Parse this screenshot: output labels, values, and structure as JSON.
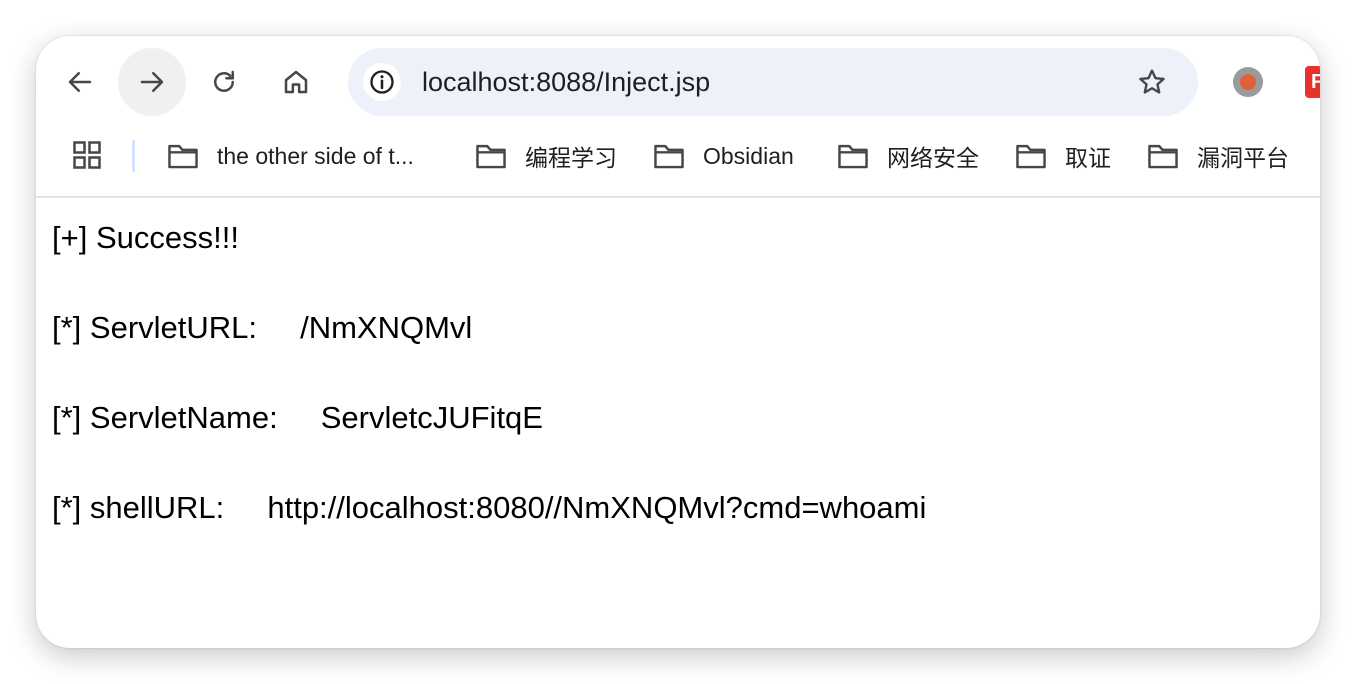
{
  "toolbar": {
    "back_icon": "arrow-left-icon",
    "forward_icon": "arrow-right-icon",
    "reload_icon": "reload-icon",
    "home_icon": "home-icon",
    "url": "localhost:8088/Inject.jsp",
    "site_info_icon": "info-icon",
    "bookmark_star_icon": "star-icon",
    "extension_icons": [
      "record-extension-icon",
      "red-extension-icon"
    ],
    "red_extension_letter": "F"
  },
  "bookmarks_bar": {
    "apps_icon": "apps-grid-icon",
    "items": [
      {
        "label": "the other side of t...",
        "icon": "folder-icon"
      },
      {
        "label": "编程学习",
        "icon": "folder-icon"
      },
      {
        "label": "Obsidian",
        "icon": "folder-icon"
      },
      {
        "label": "网络安全",
        "icon": "folder-icon"
      },
      {
        "label": "取证",
        "icon": "folder-icon"
      },
      {
        "label": "漏洞平台",
        "icon": "folder-icon"
      }
    ]
  },
  "page": {
    "lines": [
      "[+] Success!!!",
      "[*] ServletURL:     /NmXNQMvl",
      "[*] ServletName:     ServletcJUFitqE",
      "[*] shellURL:     http://localhost:8080//NmXNQMvl?cmd=whoami"
    ]
  },
  "colors": {
    "omnibox_bg": "#edf2fa",
    "hover_bg": "#eef0f2",
    "icon": "#474747",
    "record_dot": "#e0623a",
    "red_extension": "#e8312b"
  }
}
